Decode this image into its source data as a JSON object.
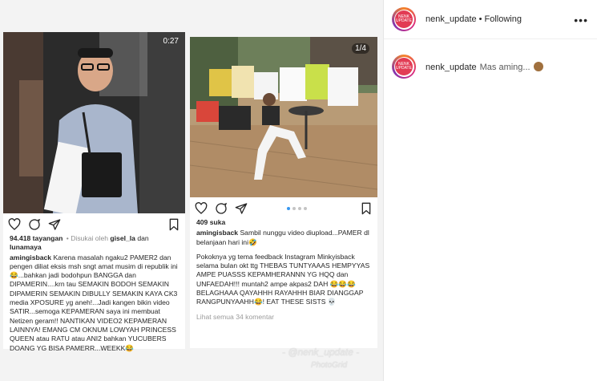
{
  "right_panel": {
    "username": "nenk_update",
    "separator": "•",
    "follow_status": "Following",
    "more": "•••",
    "avatar_text": "NENK UPDATE",
    "comment": {
      "username": "nenk_update",
      "text": "Mas aming..."
    }
  },
  "post1": {
    "timer": "0:27",
    "views": "94.418 tayangan",
    "liked_by": "Disukai oleh",
    "liker1": "gisel_la",
    "and": "dan",
    "liker2": "lunamaya",
    "username": "amingisback",
    "caption": "Karena masalah ngaku2 PAMER2 dan pengen diliat eksis msh sngt amat musim di republik ini 😂...bahkan jadi bodohpun BANGGA dan DIPAMERIN....krn tau SEMAKIN BODOH SEMAKIN DIPAMERIN SEMAKIN DIBULLY SEMAKIN KAYA CK3 media XPOSURE yg aneh!...Jadi kangen bikin video SATIR...semoga KEPAMERAN saya ini membuat Netizen geram!! NANTIKAN VIDEO2 KEPAMERAN LAINNYA! EMANG CM OKNUM LOWYAH PRINCESS QUEEN atau RATU atau ANI2 bahkan YUCUBERS DOANG YG BISA PAMERR...WEEKK😂"
  },
  "post2": {
    "counter": "1/4",
    "likes": "409 suka",
    "username": "amingisback",
    "caption1": "Sambil nunggu video diupload...PAMER dl belanjaan hari ini🤣",
    "caption2": "Pokoknya yg tema feedback Instagram Minkyisback selama bulan okt ttg THEBAS TUNTYAAAS HEMPYYAS AMPE PUASSS KEPAMHERANNN YG HQQ dan UNFAEDAH!!! muntah2 ampe akpas2 DAH 😂😂😂 BELAGHAAA QAYAHHH RAYAHHH BIAR DIANGGAP RANGPUNYAAHH😂! EAT THESE SISTS 💀",
    "view_comments": "Lihat semua 34 komentar"
  },
  "watermark": {
    "line1": "- @nenk_update -",
    "line2": "PhotoGrid"
  },
  "colors": {
    "accent": "#3897f0",
    "text": "#262626",
    "muted": "#8e8e8e"
  }
}
